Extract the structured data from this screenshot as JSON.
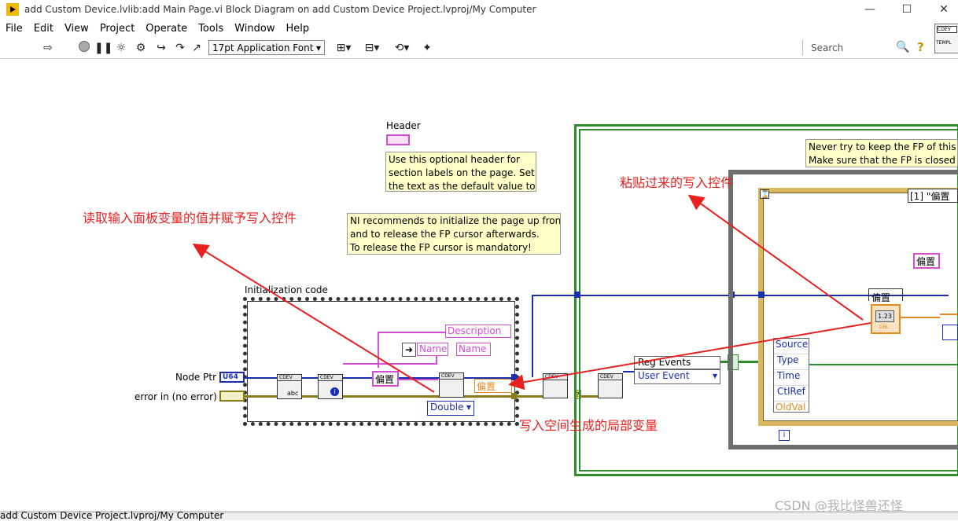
{
  "window": {
    "title": "add Custom Device.lvlib:add Main Page.vi Block Diagram on add Custom Device Project.lvproj/My Computer",
    "minimize": "—",
    "maximize": "☐",
    "close": "✕"
  },
  "menu": [
    "File",
    "Edit",
    "View",
    "Project",
    "Operate",
    "Tools",
    "Window",
    "Help"
  ],
  "toolbar": {
    "font": "17pt Application Font",
    "search_placeholder": "Search",
    "templ_label": "TEMPL"
  },
  "diagram": {
    "header_label": "Header",
    "header_note": [
      "Use this optional header for",
      "section labels on the page. Set",
      "the text as the default value to"
    ],
    "init_note": [
      "NI recommends to initialize the page up front",
      "and to release the FP cursor afterwards.",
      "To release the FP cursor is mandatory!"
    ],
    "fp_note": [
      "Never try to keep the FP of this",
      "Make sure that the FP is closed"
    ],
    "init_label": "Initialization code",
    "node_ptr": "Node Ptr",
    "error_in": "error in (no error)",
    "u64": "U64",
    "description": "Description",
    "name1": "Name",
    "name2": "Name",
    "offset_const": "偏置",
    "offset_local": "偏置",
    "offset_ctrl": "偏置",
    "offset_label": "偏置",
    "double": "Double",
    "abc": "abc",
    "reg_events": "Reg Events",
    "user_event": "User Event",
    "event_case": "[1] \"偏置",
    "event_items": [
      "Source",
      "Type",
      "Time",
      "CtlRef",
      "OldVal"
    ],
    "dbl": "DBL",
    "num_123": "1.23",
    "iter": "i",
    "cdev": "CDEV"
  },
  "annotations": {
    "read_input": "读取输入面板变量的值并赋予写入控件",
    "pasted": "粘贴过来的写入控件",
    "local_var": "写入空间生成的局部变量"
  },
  "status": {
    "text": "add Custom Device Project.lvproj/My Computer"
  },
  "watermark": "CSDN @我比怪兽还怪",
  "colors": {
    "blue_wire": "#1a2fb0",
    "pink_wire": "#d24fd2",
    "orange_wire": "#e68a1e",
    "error_wire": "#8a7a1a",
    "annotation_red": "#e82020",
    "note_bg": "#ffffc8",
    "green_frame": "#2e8b2e"
  }
}
